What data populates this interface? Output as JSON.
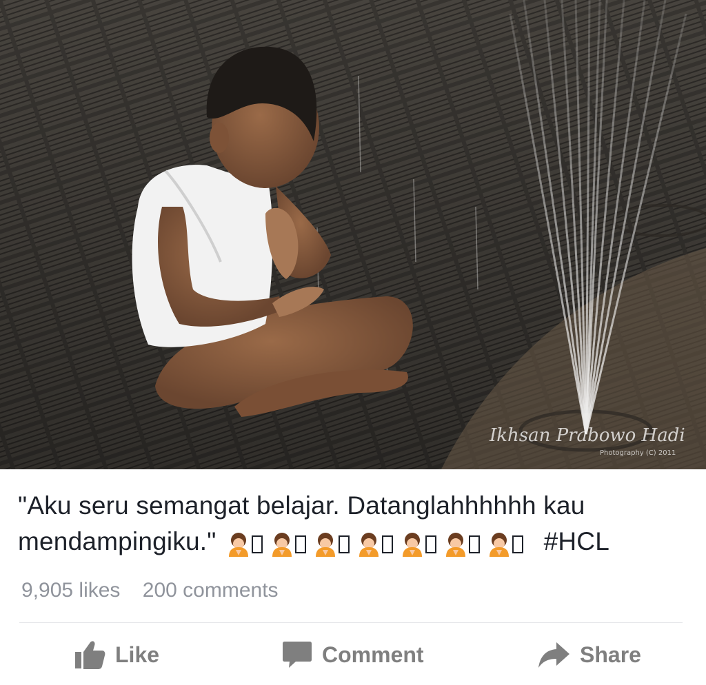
{
  "post": {
    "photo": {
      "alt": "Child sitting cross-legged praying under a water fountain",
      "watermark_name": "Ikhsan Prabowo Hadi",
      "watermark_sub": "Photography (C) 2011"
    },
    "caption_text": "\"Aku seru semangat belajar. Datanglahhhhhh kau mendampingiku.\"",
    "caption_emoji": "🙇🙏🙇🙏🙇🙏🙇🙏🙇🙏🙇🙏🙇🙏",
    "caption_hashtag": "#HCL",
    "likes_label": "9,905 likes",
    "comments_label": "200 comments"
  },
  "actions": {
    "like_label": "Like",
    "comment_label": "Comment",
    "share_label": "Share"
  },
  "colors": {
    "text": "#1d2129",
    "muted": "#90949c",
    "action": "#7f7f7f",
    "emoji_orange": "#f39b2a"
  }
}
